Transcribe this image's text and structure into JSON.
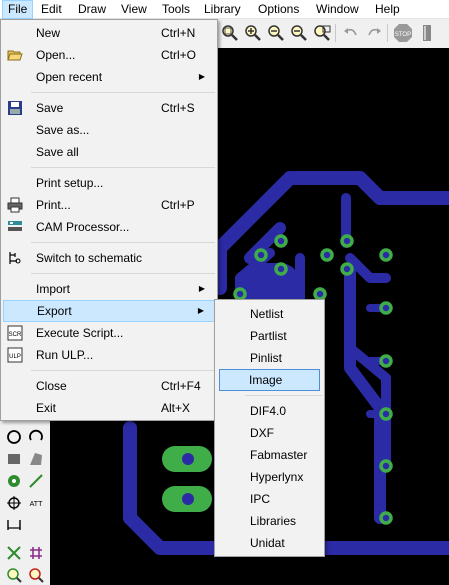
{
  "menubar": {
    "items": [
      "File",
      "Edit",
      "Draw",
      "View",
      "Tools",
      "Library",
      "Options",
      "Window",
      "Help"
    ]
  },
  "file_menu": {
    "new": {
      "label": "New",
      "shortcut": "Ctrl+N"
    },
    "open": {
      "label": "Open...",
      "shortcut": "Ctrl+O"
    },
    "open_recent": {
      "label": "Open recent"
    },
    "save": {
      "label": "Save",
      "shortcut": "Ctrl+S"
    },
    "save_as": {
      "label": "Save as..."
    },
    "save_all": {
      "label": "Save all"
    },
    "print_setup": {
      "label": "Print setup..."
    },
    "print": {
      "label": "Print...",
      "shortcut": "Ctrl+P"
    },
    "cam_processor": {
      "label": "CAM Processor..."
    },
    "switch_schematic": {
      "label": "Switch to schematic"
    },
    "import": {
      "label": "Import"
    },
    "export": {
      "label": "Export"
    },
    "execute_script": {
      "label": "Execute Script..."
    },
    "run_ulp": {
      "label": "Run ULP..."
    },
    "close": {
      "label": "Close",
      "shortcut": "Ctrl+F4"
    },
    "exit": {
      "label": "Exit",
      "shortcut": "Alt+X"
    }
  },
  "export_menu": {
    "items": [
      "Netlist",
      "Partlist",
      "Pinlist",
      "Image",
      "DIF4.0",
      "DXF",
      "Fabmaster",
      "Hyperlynx",
      "IPC",
      "Libraries",
      "Unidat"
    ]
  },
  "colors": {
    "trace": "#2b2ba6",
    "pad": "#3fae49",
    "canvas": "#000000",
    "highlight": "#cce8ff"
  }
}
